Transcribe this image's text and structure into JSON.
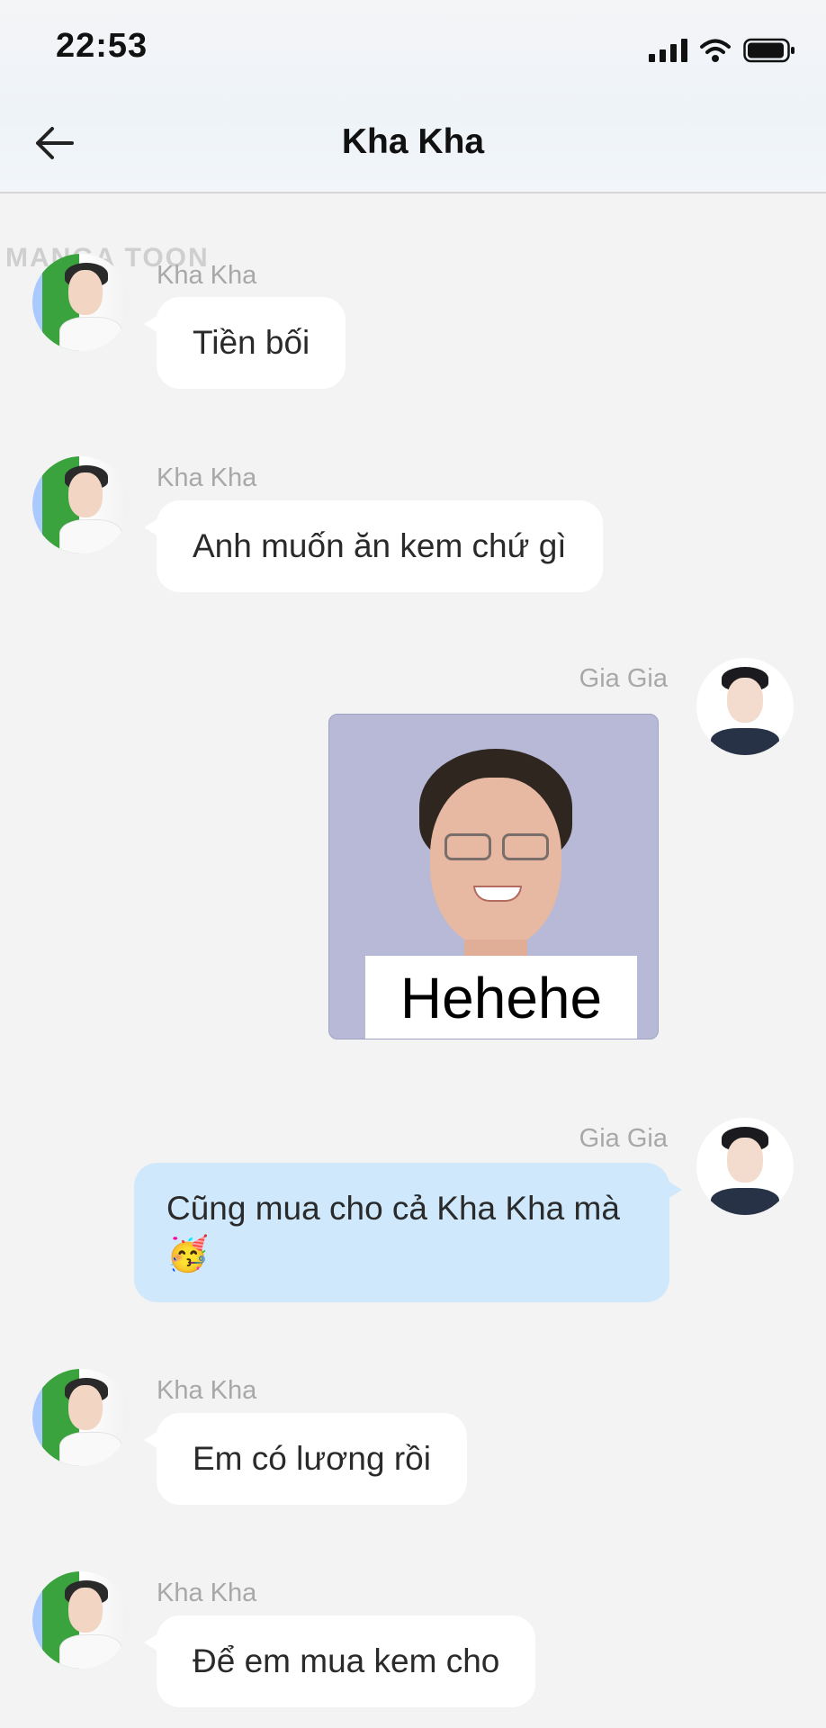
{
  "status_bar": {
    "time": "22:53",
    "icons": [
      "signal-icon",
      "wifi-icon",
      "battery-icon"
    ]
  },
  "header": {
    "back_icon": "back-arrow-icon",
    "title": "Kha Kha"
  },
  "watermark": "MANGA TOON",
  "messages": [
    {
      "side": "left",
      "sender": "Kha Kha",
      "text": "Tiền bối"
    },
    {
      "side": "left",
      "sender": "Kha Kha",
      "text": "Anh muốn ăn kem chứ gì"
    },
    {
      "side": "right",
      "sender": "Gia Gia",
      "type": "sticker",
      "caption": "Hehehe"
    },
    {
      "side": "right",
      "sender": "Gia Gia",
      "text": "Cũng mua cho cả Kha Kha mà",
      "emoji": "🥳"
    },
    {
      "side": "left",
      "sender": "Kha Kha",
      "text": "Em có lương rồi"
    },
    {
      "side": "left",
      "sender": "Kha Kha",
      "text": "Để em mua kem cho"
    }
  ],
  "colors": {
    "background": "#f3f3f3",
    "incoming_bubble": "#ffffff",
    "outgoing_bubble": "#cfe8fb",
    "sender_name": "#a8a8a8"
  }
}
